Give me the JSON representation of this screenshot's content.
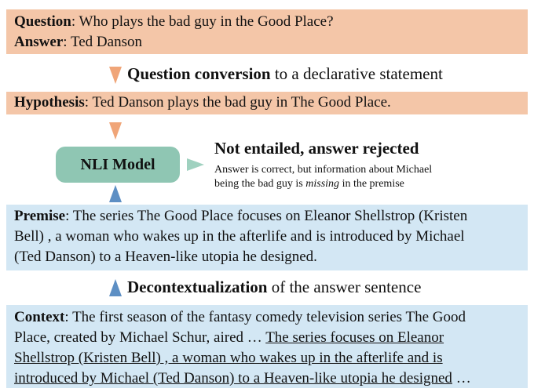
{
  "question_box": {
    "question_label": "Question",
    "question_text": "Who plays the bad guy in the Good Place?",
    "answer_label": "Answer",
    "answer_text": "Ted Danson"
  },
  "step1": {
    "bold": "Question conversion",
    "rest": " to a declarative statement"
  },
  "hypothesis_box": {
    "label": "Hypothesis",
    "text": "Ted Danson plays the bad guy in The Good Place."
  },
  "nli_model": {
    "label": "NLI Model"
  },
  "result": {
    "title": "Not entailed, answer rejected",
    "line1": "Answer is correct, but information about Michael",
    "line2_pre": "being the bad guy is ",
    "line2_em": "missing",
    "line2_post": " in the premise"
  },
  "premise_box": {
    "label": "Premise",
    "line1": "The series The Good Place focuses on Eleanor Shellstrop (Kristen",
    "line2": "Bell) , a woman who wakes up in the afterlife and is introduced by Michael",
    "line3": "(Ted Danson) to a Heaven-like utopia he designed."
  },
  "step2": {
    "bold": "Decontextualization",
    "rest": " of the answer sentence"
  },
  "context_box": {
    "label": "Context",
    "line1": "The first season of the fantasy comedy television series The Good",
    "line2_plain": "Place, created by Michael Schur, aired … ",
    "line2_underlined": "The series focuses on Eleanor",
    "line3": "Shellstrop (Kristen Bell) , a woman who wakes up in the afterlife and is",
    "line4_underlined": "introduced by Michael (Ted Danson) to a Heaven-like utopia he designed",
    "line4_tail": " …"
  },
  "colors": {
    "orange_box": "#f4c6a8",
    "blue_box": "#d3e7f4",
    "nli_box": "#8fc6b3",
    "arrow_orange": "#f0a578",
    "arrow_blue": "#5d8fc4",
    "arrow_green": "#9fd1bf"
  }
}
